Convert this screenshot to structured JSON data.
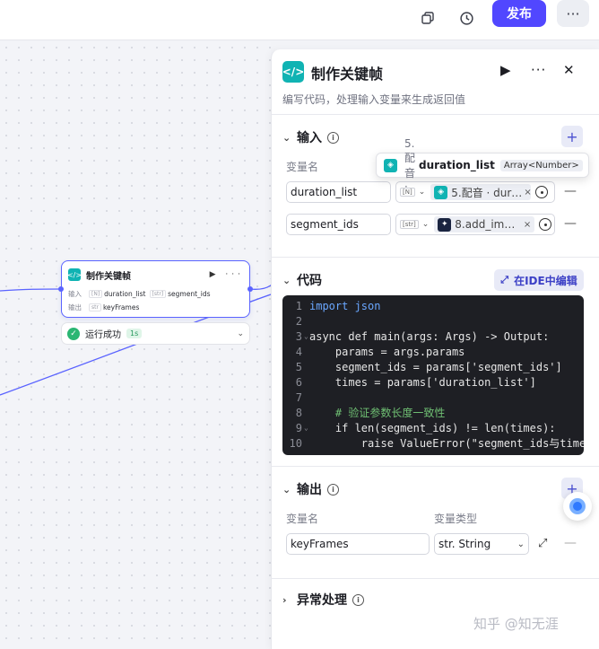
{
  "topbar": {
    "publish_label": "发布",
    "more_label": "···"
  },
  "canvas": {
    "node": {
      "title": "制作关键帧",
      "actions": "▶ ···",
      "input_label": "输入",
      "input_items": [
        {
          "type": "[N]",
          "name": "duration_list"
        },
        {
          "type": "[str]",
          "name": "segment_ids"
        }
      ],
      "output_label": "输出",
      "output_items": [
        {
          "type": "str",
          "name": "keyFrames"
        }
      ]
    },
    "run_status": {
      "label": "运行成功",
      "duration": "1s"
    }
  },
  "panel": {
    "title": "制作关键帧",
    "description": "编写代码，处理输入变量来生成返回值",
    "input_section": {
      "title": "输入",
      "column_name": "变量名",
      "rows": [
        {
          "name": "duration_list",
          "type_tag": "[N]",
          "ref": "5.配音 · dur…"
        },
        {
          "name": "segment_ids",
          "type_tag": "[str]",
          "ref": "8.add_im…"
        }
      ],
      "tooltip": {
        "source": "5.配音 ·",
        "name": "duration_list",
        "type": "Array<Number>"
      }
    },
    "code_section": {
      "title": "代码",
      "ide_button": "在IDE中编辑",
      "lines": [
        {
          "n": "1",
          "text": "import json"
        },
        {
          "n": "2",
          "text": ""
        },
        {
          "n": "3",
          "text": "async def main(args: Args) -> Output:"
        },
        {
          "n": "4",
          "text": "    params = args.params"
        },
        {
          "n": "5",
          "text": "    segment_ids = params['segment_ids']"
        },
        {
          "n": "6",
          "text": "    times = params['duration_list']"
        },
        {
          "n": "7",
          "text": ""
        },
        {
          "n": "8",
          "text": "    # 验证参数长度一致性"
        },
        {
          "n": "9",
          "text": "    if len(segment_ids) != len(times):"
        },
        {
          "n": "10",
          "text": "        raise ValueError(\"segment_ids与time"
        }
      ]
    },
    "output_section": {
      "title": "输出",
      "column_name": "变量名",
      "column_type": "变量类型",
      "rows": [
        {
          "name": "keyFrames",
          "type": "str. String"
        }
      ]
    },
    "error_section": {
      "title": "异常处理"
    }
  },
  "watermark": "知乎 @知无涯"
}
